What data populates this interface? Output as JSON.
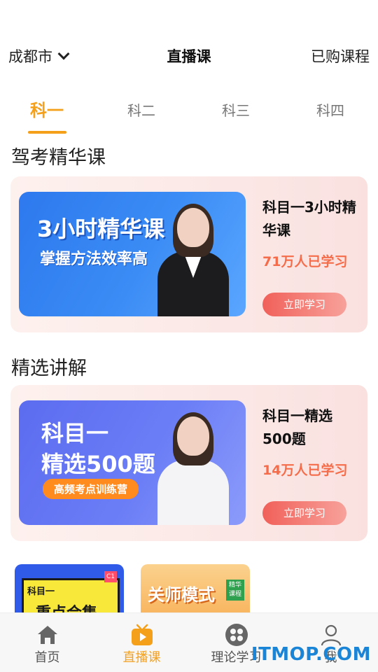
{
  "header": {
    "city": "成都市",
    "title": "直播课",
    "purchased": "已购课程"
  },
  "tabs": [
    {
      "label": "科一",
      "active": true
    },
    {
      "label": "科二",
      "active": false
    },
    {
      "label": "科三",
      "active": false
    },
    {
      "label": "科四",
      "active": false
    }
  ],
  "sections": [
    {
      "title": "驾考精华课",
      "card": {
        "thumb_title": "3小时精华课",
        "thumb_sub": "掌握方法效率高",
        "title": "科目一3小时精华课",
        "count": "71万人已学习",
        "button": "立即学习"
      }
    },
    {
      "title": "精选讲解",
      "card": {
        "thumb_line1": "科目一",
        "thumb_line2": "精选500题",
        "thumb_pill": "高频考点训练营",
        "title": "科目一精选500题",
        "count": "14万人已学习",
        "button": "立即学习"
      }
    }
  ],
  "minis": [
    {
      "line1": "科目一",
      "line2": "重点合集",
      "badge": "C1"
    },
    {
      "line1": "关师模式",
      "tag": "精华课程"
    }
  ],
  "nav": [
    {
      "label": "首页",
      "icon": "home-icon",
      "active": false
    },
    {
      "label": "直播课",
      "icon": "play-tv-icon",
      "active": true
    },
    {
      "label": "理论学习",
      "icon": "grid-circle-icon",
      "active": false
    },
    {
      "label": "我",
      "icon": "person-icon",
      "active": false
    }
  ],
  "watermark": "ITMOP.COM",
  "colors": {
    "accent": "#f5a01a",
    "count": "#f56c4a",
    "button_start": "#f0615a",
    "button_end": "#f7a19a"
  }
}
